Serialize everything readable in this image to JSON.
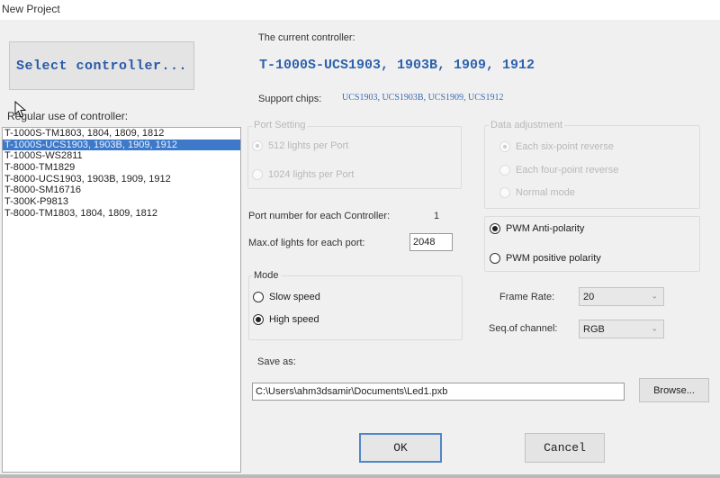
{
  "window": {
    "title": "New Project"
  },
  "left": {
    "select_button": "Select controller...",
    "regular_use_label": "Regular use of controller:",
    "controllers": [
      "T-1000S-TM1803, 1804, 1809, 1812",
      "T-1000S-UCS1903, 1903B, 1909, 1912",
      "T-1000S-WS2811",
      "T-8000-TM1829",
      "T-8000-UCS1903, 1903B, 1909, 1912",
      "T-8000-SM16716",
      "T-300K-P9813",
      "T-8000-TM1803, 1804, 1809, 1812"
    ],
    "selected_index": 1
  },
  "current": {
    "label": "The current controller:",
    "value": "T-1000S-UCS1903, 1903B, 1909, 1912",
    "chips_label": "Support chips:",
    "chips_value": "UCS1903, UCS1903B, UCS1909, UCS1912"
  },
  "port_setting": {
    "title": "Port Setting",
    "enabled": false,
    "options": [
      {
        "label": "512 lights per Port",
        "checked": true
      },
      {
        "label": "1024 lights per Port",
        "checked": false
      }
    ]
  },
  "data_adjustment": {
    "title": "Data adjustment",
    "enabled": false,
    "options": [
      {
        "label": "Each six-point reverse",
        "checked": true
      },
      {
        "label": "Each four-point reverse",
        "checked": false
      },
      {
        "label": "Normal mode",
        "checked": false
      }
    ]
  },
  "port_info": {
    "port_number_label": "Port number for each Controller:",
    "port_number_value": "1",
    "max_lights_label": "Max.of lights for each port:",
    "max_lights_value": "2048"
  },
  "polarity": {
    "options": [
      {
        "label": "PWM Anti-polarity",
        "checked": true
      },
      {
        "label": "PWM positive polarity",
        "checked": false
      }
    ]
  },
  "mode": {
    "title": "Mode",
    "options": [
      {
        "label": "Slow speed",
        "checked": false
      },
      {
        "label": "High speed",
        "checked": true
      }
    ]
  },
  "frame_rate": {
    "label": "Frame Rate:",
    "value": "20"
  },
  "channel_seq": {
    "label": "Seq.of channel:",
    "value": "RGB"
  },
  "save": {
    "label": "Save as:",
    "path": "C:\\Users\\ahm3dsamir\\Documents\\Led1.pxb",
    "browse_label": "Browse..."
  },
  "actions": {
    "ok_label": "OK",
    "cancel_label": "Cancel"
  },
  "colors": {
    "accent": "#2e62ae",
    "selection": "#3d79c8"
  }
}
